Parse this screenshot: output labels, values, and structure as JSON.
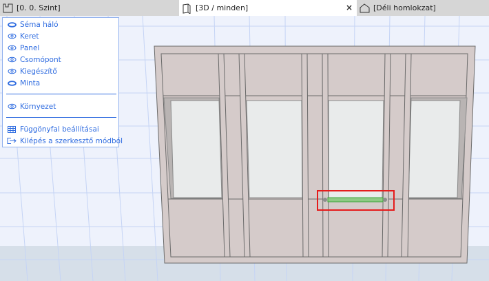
{
  "tabs": [
    {
      "label": "[0. 0. Szint]",
      "icon": "floor-plan-icon"
    },
    {
      "label": "[3D / minden]",
      "icon": "3d-box-icon",
      "active": true,
      "close": "×"
    },
    {
      "label": "[Déli homlokzat]",
      "icon": "elevation-house-icon"
    }
  ],
  "menu": {
    "items": [
      {
        "label": "Séma háló",
        "icon": "eye-closed-icon"
      },
      {
        "label": "Keret",
        "icon": "eye-icon"
      },
      {
        "label": "Panel",
        "icon": "eye-icon"
      },
      {
        "label": "Csomópont",
        "icon": "eye-icon"
      },
      {
        "label": "Kiegészítő",
        "icon": "eye-icon"
      },
      {
        "label": "Minta",
        "icon": "eye-closed-icon"
      }
    ],
    "environment": {
      "label": "Környezet",
      "icon": "eye-icon"
    },
    "settings": {
      "label": "Függönyfal beállításai",
      "icon": "curtain-wall-settings-icon"
    },
    "exit": {
      "label": "Kilépés a szerkesztő módból",
      "icon": "exit-icon"
    }
  },
  "colors": {
    "accent": "#2f6ce0",
    "selection": "#e51b1b",
    "highlight": "#5ab14a",
    "wall": "#d5cbca",
    "glass": "#e9ebeb"
  }
}
